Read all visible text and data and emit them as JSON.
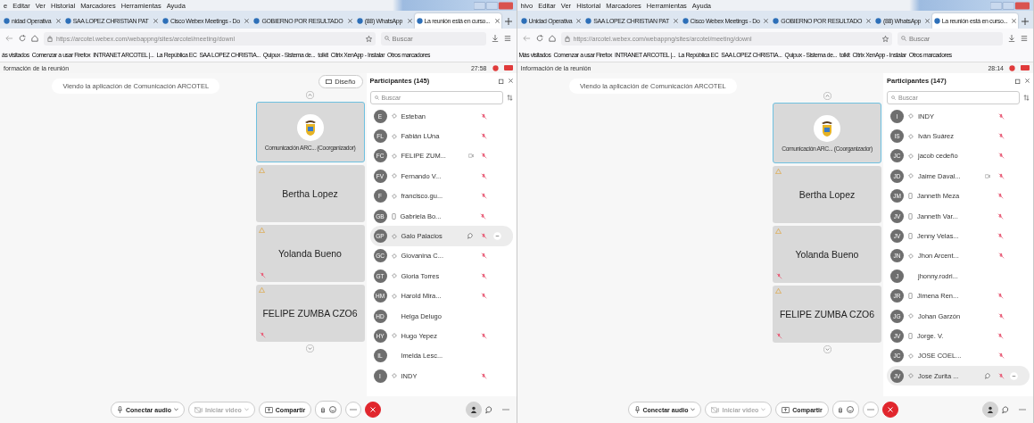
{
  "windows": [
    {
      "menu": [
        "e",
        "Editar",
        "Ver",
        "Historial",
        "Marcadores",
        "Herramientas",
        "Ayuda"
      ],
      "tabs": [
        {
          "label": "nidad Operativa",
          "selected": false
        },
        {
          "label": "SAA LOPEZ CHRISTIAN PAT",
          "selected": false
        },
        {
          "label": "Cisco Webex Meetings - Do",
          "selected": false
        },
        {
          "label": "GOBIERNO POR RESULTADO",
          "selected": false
        },
        {
          "label": "(88) WhatsApp",
          "selected": false
        },
        {
          "label": "La reunión está en curso...",
          "selected": true
        }
      ],
      "address": "https://arcotel.webex.com/webappng/sites/arcotel/meeting/downl",
      "search_placeholder": "Buscar",
      "bookmarks": [
        "ás visitados",
        "Comenzar a usar Firefox",
        "INTRANET ARCOTEL |...",
        "La República EC",
        "SAA LOPEZ CHRISTIA...",
        "Quipux - Sistema de...",
        "tolkit",
        "Citrix XenApp - Instalar",
        "Otros marcadores"
      ],
      "meeting_info": "formación de la reunión",
      "timer": "27:58",
      "banner": "Viendo la aplicación de Comunicación ARCOTEL",
      "layout_button": "Diseño",
      "tiles": [
        {
          "kind": "host",
          "name": "Comunicación ARC...",
          "role": "(Coorganizador)",
          "muted": false
        },
        {
          "kind": "person",
          "name": "Bertha Lopez",
          "muted": false
        },
        {
          "kind": "person",
          "name": "Yolanda Bueno",
          "muted": true
        },
        {
          "kind": "person",
          "name": "FELIPE ZUMBA CZO6",
          "muted": true
        }
      ],
      "participants": {
        "title": "Participantes (145)",
        "search_placeholder": "Buscar",
        "items": [
          {
            "initials": "E",
            "name": "Esteban",
            "kind": "web",
            "muted": true,
            "selected": false
          },
          {
            "initials": "FL",
            "name": "Fabián LUna",
            "kind": "web",
            "muted": true,
            "selected": false
          },
          {
            "initials": "FC",
            "name": "FELIPE ZUM...",
            "kind": "web",
            "muted": true,
            "selected": false,
            "video": true
          },
          {
            "initials": "FV",
            "name": "Fernando V...",
            "kind": "web",
            "muted": true,
            "selected": false
          },
          {
            "initials": "F",
            "name": "francisco.gu...",
            "kind": "web",
            "muted": true,
            "selected": false
          },
          {
            "initials": "GB",
            "name": "Gabriela Bo...",
            "kind": "phone",
            "muted": true,
            "selected": false
          },
          {
            "initials": "GP",
            "name": "Galo Palacios",
            "kind": "web",
            "muted": true,
            "selected": true
          },
          {
            "initials": "GC",
            "name": "Giovanina C...",
            "kind": "web",
            "muted": true,
            "selected": false
          },
          {
            "initials": "GT",
            "name": "Gloria Torres",
            "kind": "web",
            "muted": true,
            "selected": false
          },
          {
            "initials": "HM",
            "name": "Harold Mira...",
            "kind": "web",
            "muted": true,
            "selected": false
          },
          {
            "initials": "HD",
            "name": "Helga Delugo",
            "kind": "plain",
            "muted": false,
            "selected": false
          },
          {
            "initials": "HY",
            "name": "Hugo Yepez",
            "kind": "web",
            "muted": true,
            "selected": false
          },
          {
            "initials": "IL",
            "name": "Imelda Lesc...",
            "kind": "plain",
            "muted": false,
            "selected": false
          },
          {
            "initials": "I",
            "name": "INDY",
            "kind": "web",
            "muted": true,
            "selected": false
          }
        ]
      },
      "controls": [
        {
          "kind": "audio",
          "label": "Conectar audio",
          "disabled": false
        },
        {
          "kind": "video",
          "label": "Iniciar video",
          "disabled": true
        },
        {
          "kind": "share",
          "label": "Compartir",
          "disabled": false
        }
      ]
    },
    {
      "menu": [
        "hivo",
        "Editar",
        "Ver",
        "Historial",
        "Marcadores",
        "Herramientas",
        "Ayuda"
      ],
      "tabs": [
        {
          "label": "Unidad Operativa",
          "selected": false
        },
        {
          "label": "SAA LOPEZ CHRISTIAN PAT",
          "selected": false
        },
        {
          "label": "Cisco Webex Meetings - Do",
          "selected": false
        },
        {
          "label": "GOBIERNO POR RESULTADO",
          "selected": false
        },
        {
          "label": "(88) WhatsApp",
          "selected": false
        },
        {
          "label": "La reunión está en curso...",
          "selected": true
        }
      ],
      "address": "https://arcotel.webex.com/webappng/sites/arcotel/meeting/downl",
      "search_placeholder": "Buscar",
      "bookmarks": [
        "Más visitados",
        "Comenzar a usar Firefox",
        "INTRANET ARCOTEL |...",
        "La República EC",
        "SAA LOPEZ CHRISTIA...",
        "Quipux - Sistema de...",
        "tolkit",
        "Citrix XenApp - Instalar",
        "Otros marcadores"
      ],
      "meeting_info": "Información de la reunión",
      "timer": "28:14",
      "banner": "Viendo la aplicación de Comunicación ARCOTEL",
      "tiles": [
        {
          "kind": "host",
          "name": "Comunicación ARC...",
          "role": "(Coorganizador)",
          "muted": false
        },
        {
          "kind": "person",
          "name": "Bertha Lopez",
          "muted": false
        },
        {
          "kind": "person",
          "name": "Yolanda Bueno",
          "muted": true
        },
        {
          "kind": "person",
          "name": "FELIPE ZUMBA CZO6",
          "muted": true
        }
      ],
      "participants": {
        "title": "Participantes (147)",
        "search_placeholder": "Buscar",
        "items": [
          {
            "initials": "I",
            "name": "INDY",
            "kind": "web",
            "muted": true,
            "selected": false
          },
          {
            "initials": "IS",
            "name": "Iván Suárez",
            "kind": "web",
            "muted": true,
            "selected": false
          },
          {
            "initials": "JC",
            "name": "jacob cedeño",
            "kind": "web",
            "muted": true,
            "selected": false
          },
          {
            "initials": "JD",
            "name": "Jaime Daval...",
            "kind": "web",
            "muted": true,
            "selected": false,
            "video": true
          },
          {
            "initials": "JM",
            "name": "Janneth Meza",
            "kind": "phone",
            "muted": true,
            "selected": false
          },
          {
            "initials": "JV",
            "name": "Janneth Var...",
            "kind": "phone",
            "muted": true,
            "selected": false
          },
          {
            "initials": "JV",
            "name": "Jenny Velas...",
            "kind": "phone",
            "muted": true,
            "selected": false
          },
          {
            "initials": "JN",
            "name": "Jhon Arcent...",
            "kind": "web",
            "muted": true,
            "selected": false
          },
          {
            "initials": "J",
            "name": "jhonny.rodri...",
            "kind": "plain",
            "muted": false,
            "selected": false
          },
          {
            "initials": "JR",
            "name": "Jimena Ren...",
            "kind": "phone",
            "muted": true,
            "selected": false
          },
          {
            "initials": "JG",
            "name": "Johan Garzón",
            "kind": "web",
            "muted": true,
            "selected": false
          },
          {
            "initials": "JV",
            "name": "Jorge. V.",
            "kind": "phone",
            "muted": true,
            "selected": false
          },
          {
            "initials": "JC",
            "name": "JOSE COEL...",
            "kind": "web",
            "muted": true,
            "selected": false
          },
          {
            "initials": "JV",
            "name": "Jose Zurita ...",
            "kind": "web",
            "muted": true,
            "selected": true
          }
        ]
      },
      "controls": [
        {
          "kind": "audio",
          "label": "Conectar audio",
          "disabled": false
        },
        {
          "kind": "video",
          "label": "Iniciar video",
          "disabled": true
        },
        {
          "kind": "share",
          "label": "Compartir",
          "disabled": false
        }
      ]
    }
  ]
}
